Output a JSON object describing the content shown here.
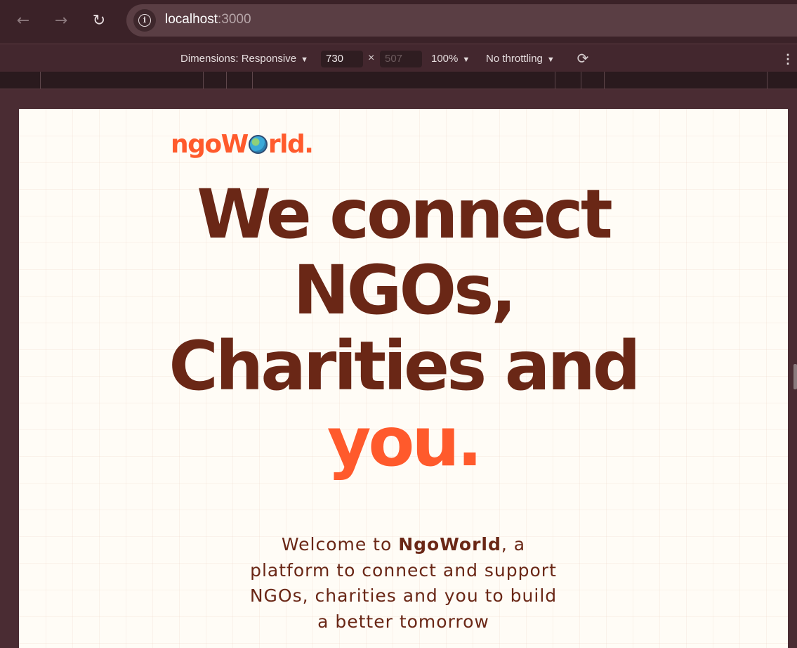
{
  "browser": {
    "back_icon": "arrow-left-icon",
    "forward_icon": "arrow-right-icon",
    "reload_icon": "reload-icon",
    "info_icon": "info-icon",
    "url_host": "localhost",
    "url_port": ":3000"
  },
  "devtools": {
    "dimensions_label": "Dimensions: Responsive",
    "width_value": "730",
    "height_value": "507",
    "times_symbol": "×",
    "zoom_label": "100%",
    "throttling_label": "No throttling",
    "rotate_icon": "rotate-icon",
    "more_icon": "more-vert-icon"
  },
  "page": {
    "logo_prefix": "ngoW",
    "logo_suffix": "rld.",
    "headline": {
      "line1": "We connect",
      "line2": "NGOs,",
      "line3": "Charities and",
      "line4_accent": "you."
    },
    "intro": {
      "before": "Welcome to ",
      "brand": "NgoWorld",
      "after": ", a platform to connect and support NGOs, charities and you to build a better tomorrow"
    }
  },
  "colors": {
    "brand_orange": "#ff5a2c",
    "brand_brown": "#6a2716",
    "page_bg": "#fffcf6",
    "chrome_bg": "#3b2228"
  }
}
